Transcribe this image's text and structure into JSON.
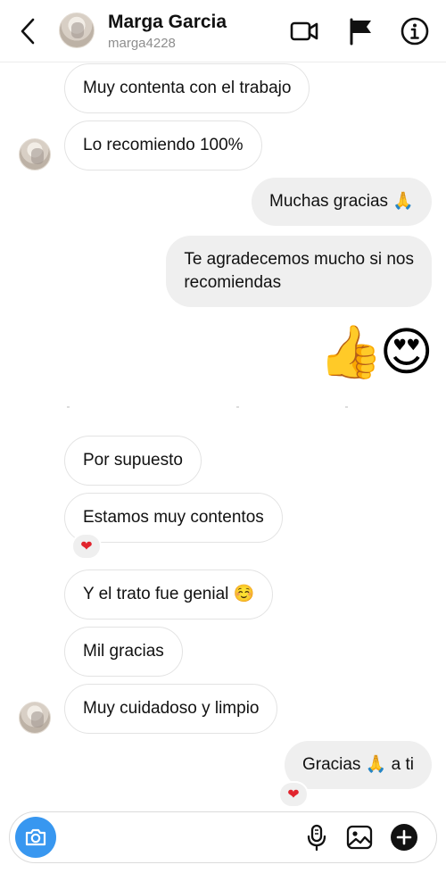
{
  "header": {
    "name": "Marga Garcia",
    "handle": "marga4228"
  },
  "messages": [
    {
      "text": "Muy contenta con el trabajo"
    },
    {
      "text": "Lo recomiendo 100%"
    },
    {
      "text": "Muchas gracias 🙏"
    },
    {
      "line1": "Te agradecemos mucho si nos",
      "line2": "recomiendas"
    },
    {
      "text": "👍😍"
    },
    {
      "text": "Por supuesto"
    },
    {
      "text": "Estamos muy contentos",
      "reaction": "❤"
    },
    {
      "text": "Y el trato fue genial ☺️"
    },
    {
      "text": "Mil gracias"
    },
    {
      "text": "Muy cuidadoso y limpio"
    },
    {
      "text": "Gracias 🙏 a ti",
      "reaction": "❤"
    }
  ],
  "composer": {
    "placeholder": ""
  },
  "icons": {
    "back": "back-icon",
    "video": "video-call-icon",
    "flag": "flag-icon",
    "info": "info-icon",
    "camera": "camera-icon",
    "mic": "microphone-icon",
    "gallery": "gallery-icon",
    "add": "plus-icon"
  },
  "colors": {
    "accent": "#3897f0",
    "outgoing_bubble": "#efefef",
    "incoming_border": "#e3e3e3",
    "heart": "#e1242d",
    "handle": "#8e8e8e"
  }
}
